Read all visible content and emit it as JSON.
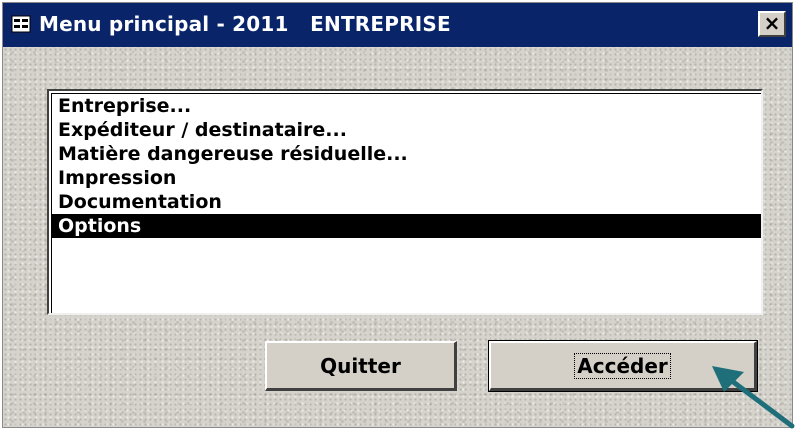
{
  "window": {
    "title": "Menu principal - 2011   ENTREPRISE",
    "title_icon": "form-icon",
    "close_symbol": "×",
    "titlebar_color": "#0a246a"
  },
  "menu_list": {
    "items": [
      {
        "label": "Entreprise..."
      },
      {
        "label": "Expéditeur / destinataire..."
      },
      {
        "label": "Matière dangereuse résiduelle..."
      },
      {
        "label": "Impression"
      },
      {
        "label": "Documentation"
      },
      {
        "label": "Options",
        "selected": true
      }
    ],
    "selected_label": "Options"
  },
  "buttons": {
    "quit_label": "Quitter",
    "access_label": "Accéder"
  },
  "annotation": {
    "arrow_icon": "pointer-arrow-icon",
    "arrow_color": "#1f6f7a"
  }
}
